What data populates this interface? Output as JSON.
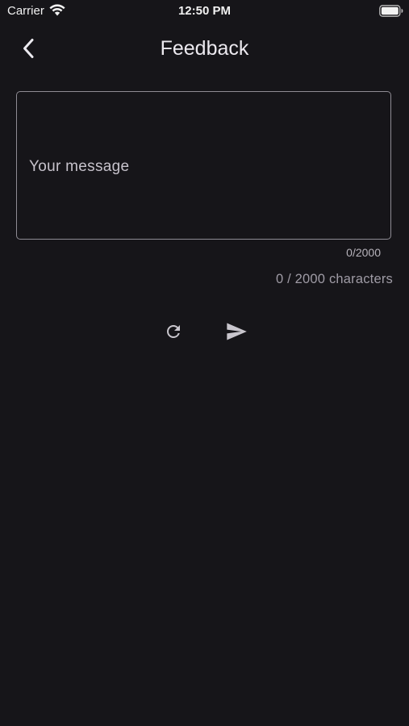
{
  "status_bar": {
    "carrier": "Carrier",
    "time": "12:50 PM",
    "wifi_icon": "wifi-icon",
    "battery_icon": "battery-icon"
  },
  "app_bar": {
    "title": "Feedback",
    "back_icon": "chevron-left-icon"
  },
  "form": {
    "message_placeholder": "Your message",
    "message_value": "",
    "counter_small": "0/2000",
    "counter_large": "0 / 2000 characters"
  },
  "actions": {
    "reset_icon": "refresh-icon",
    "send_icon": "send-icon"
  },
  "colors": {
    "background": "#161519",
    "text": "#e6e3e8",
    "outline": "#8f8c94",
    "muted": "#9f9ba5"
  }
}
